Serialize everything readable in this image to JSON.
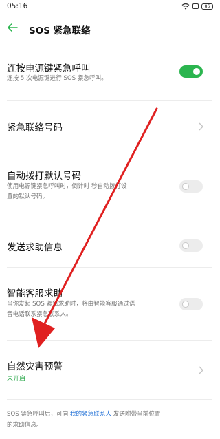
{
  "status_bar": {
    "time": "05:16",
    "icons": [
      "wifi-icon",
      "sim-icon",
      "battery-icon"
    ],
    "battery": "86"
  },
  "header": {
    "back_icon": "back-arrow-icon",
    "title": "SOS 紧急联络"
  },
  "settings": {
    "power_key_sos": {
      "title": "连按电源键紧急呼叫",
      "subtitle": "连按 5 次电源键进行 SOS 紧急呼叫。",
      "enabled": true
    },
    "emergency_number": {
      "title": "紧急联络号码"
    },
    "auto_dial": {
      "title": "自动拨打默认号码",
      "subtitle_line1": "使用电源键紧急呼叫时，倒计时",
      "subtitle_line1b": "秒自动拨打设",
      "subtitle_line2": "置的默认号码。",
      "enabled": false
    },
    "send_help": {
      "title": "发送求助信息",
      "enabled": false
    },
    "smart_service": {
      "title": "智能客服求助",
      "subtitle_line1": "当你发起 SOS 紧急求助时，将由智能客服通过语",
      "subtitle_line2": "音电话联系紧急联系人。",
      "enabled": false
    },
    "disaster_alert": {
      "title": "自然灾害预警",
      "status": "未开启"
    }
  },
  "footer": {
    "text_before": "SOS 紧急呼叫后，可向 ",
    "link": "我的紧急联系人",
    "text_after": " 发送附带当前位置",
    "line2": "的求助信息。"
  },
  "colors": {
    "accent_green": "#2bb54f",
    "link_blue": "#1f6fd6",
    "annotation_red": "#e02020"
  }
}
